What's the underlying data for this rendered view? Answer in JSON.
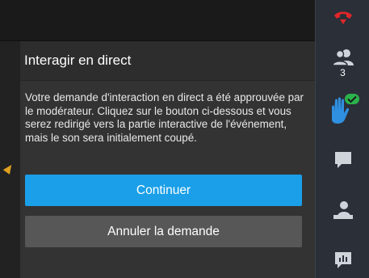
{
  "dialog": {
    "title": "Interagir en direct",
    "message": "Votre demande d'interaction en direct a été approuvée par le modérateur. Cliquez sur le bouton ci-dessous et vous serez redirigé vers la partie interactive de l'événement, mais le son sera initialement coupé.",
    "continue_label": "Continuer",
    "cancel_label": "Annuler la demande"
  },
  "rail": {
    "participants_count": "3"
  },
  "colors": {
    "primary_button": "#1a9fe8",
    "secondary_button": "#575757",
    "hangup": "#e0262a",
    "hand_raised": "#2f8fe0",
    "check_badge": "#2bb34b",
    "rail_icon": "#cfd3da"
  },
  "icons": [
    "hang-up-icon",
    "participants-icon",
    "raise-hand-icon",
    "check-badge-icon",
    "chat-icon",
    "share-icon",
    "poll-icon",
    "arrow-icon"
  ]
}
